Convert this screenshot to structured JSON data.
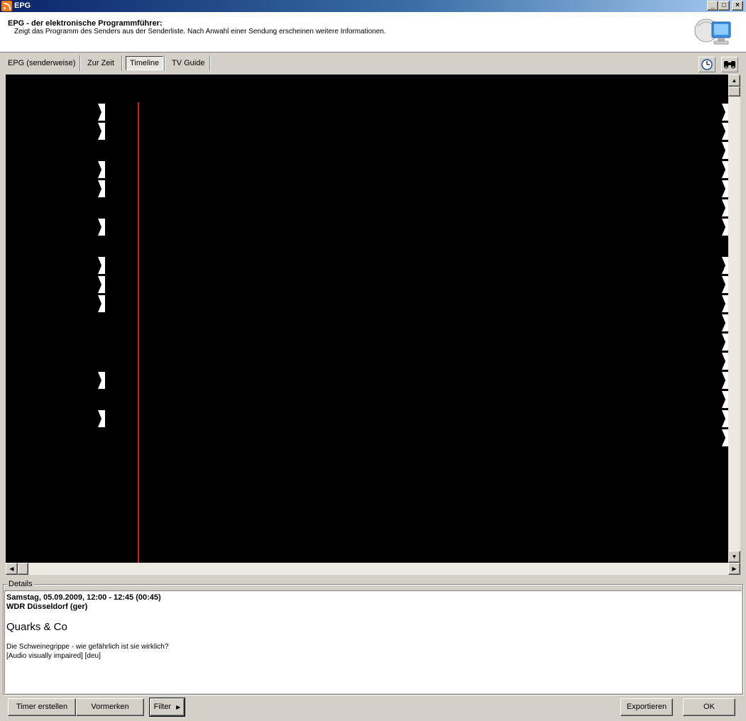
{
  "window": {
    "title": "EPG",
    "minimize_glyph": "_",
    "maximize_glyph": "□",
    "close_glyph": "×"
  },
  "header": {
    "title": "EPG - der elektronische Programmführer:",
    "description": "Zeigt das Programm des Senders aus der Senderliste. Nach Anwahl einer Sendung erscheinen weitere Informationen."
  },
  "tabs": [
    {
      "label": "EPG (senderweise)",
      "active": false
    },
    {
      "label": "Zur Zeit",
      "active": false
    },
    {
      "label": "Timeline",
      "active": true
    },
    {
      "label": "TV Guide",
      "active": false
    }
  ],
  "toolbar": {
    "clock_icon": "clock-icon",
    "search_icon": "binoculars-icon"
  },
  "timeline": {
    "background": "#000000",
    "now_line_color": "#cc1a1a",
    "marker_color": "#ffffff",
    "row_count": 18,
    "left_marker_rows": [
      0,
      1,
      3,
      4,
      6,
      8,
      9,
      10,
      14,
      16
    ],
    "right_marker_rows": [
      0,
      1,
      2,
      3,
      4,
      5,
      6,
      8,
      9,
      10,
      11,
      12,
      13,
      14,
      15,
      16,
      17
    ]
  },
  "scrollbars": {
    "up": "▲",
    "down": "▼",
    "left": "◀",
    "right": "▶"
  },
  "details": {
    "legend": "Details",
    "datetime_line": "Samstag, 05.09.2009, 12:00 - 12:45  (00:45)",
    "channel_line": "WDR Düsseldorf (ger)",
    "program_title": "Quarks & Co",
    "description": "Die Schweinegrippe - wie gefährlich ist sie wirklich?",
    "extra": "[Audio visually impaired] [deu]"
  },
  "buttons": {
    "timer": "Timer erstellen",
    "remember": "Vormerken",
    "filter": "Filter",
    "filter_arrow": "▶",
    "export": "Exportieren",
    "ok": "OK"
  }
}
